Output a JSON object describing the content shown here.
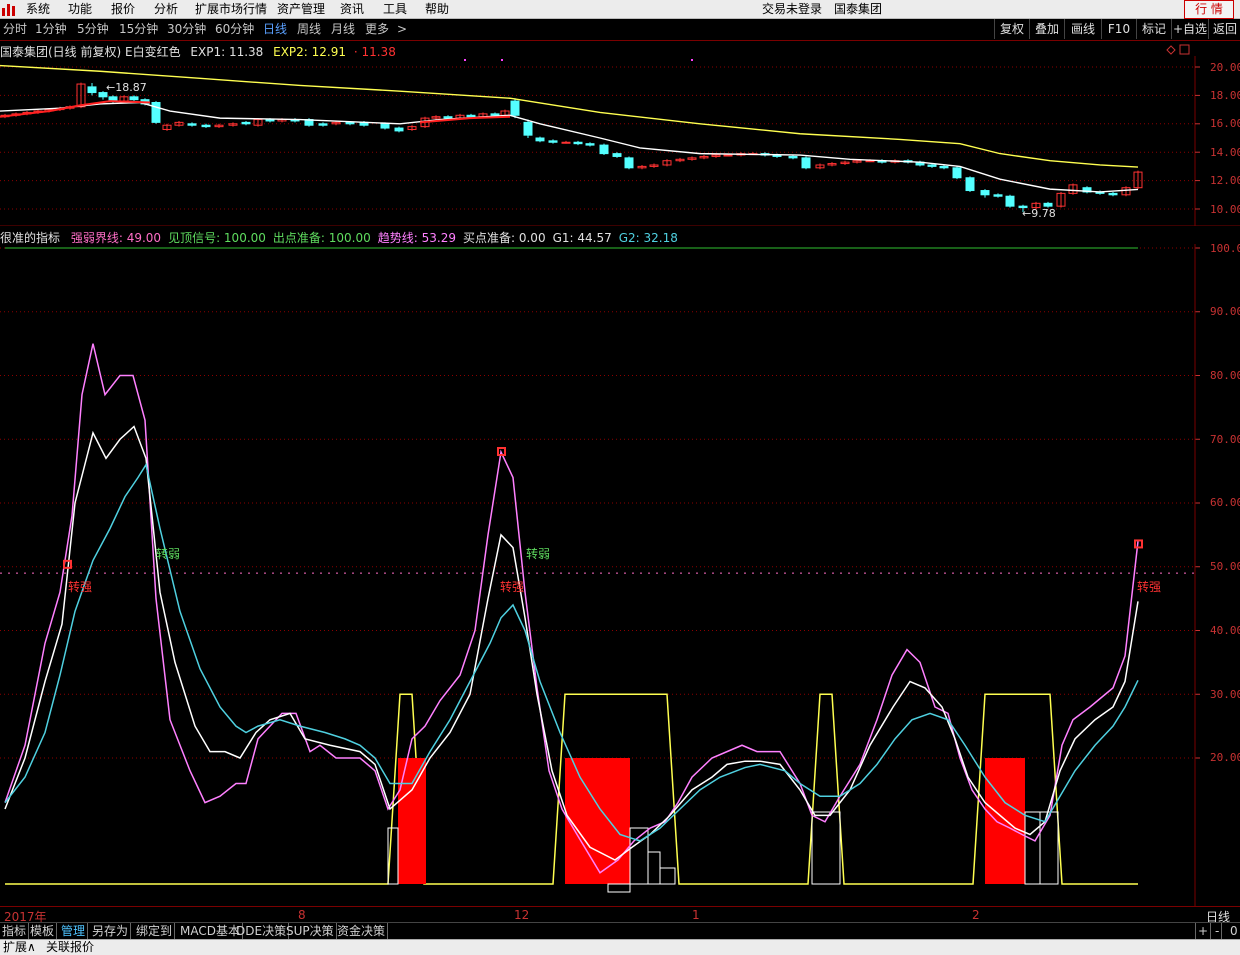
{
  "menu": {
    "items": [
      "系统",
      "功能",
      "报价",
      "分析",
      "扩展市场行情",
      "资产管理",
      "资讯",
      "工具",
      "帮助"
    ],
    "login_status": "交易未登录",
    "stock_name": "国泰集团",
    "quote_button": "行 情"
  },
  "periods": {
    "items": [
      "分时",
      "1分钟",
      "5分钟",
      "15分钟",
      "30分钟",
      "60分钟",
      "日线",
      "周线",
      "月线",
      "更多"
    ],
    "more_arrow": ">",
    "active": "日线",
    "tools": [
      "复权",
      "叠加",
      "画线",
      "F10",
      "标记",
      "+自选",
      "返回"
    ]
  },
  "main_panel": {
    "title": "国泰集团(日线 前复权) E白变红色",
    "exp1_label": "EXP1: 11.38",
    "exp2_label": "EXP2: 12.91",
    "price_label": "· 11.38",
    "high_label": "18.87",
    "low_label": "9.78",
    "axis": [
      "20.00",
      "18.00",
      "16.00",
      "14.00",
      "12.00",
      "10.00"
    ]
  },
  "indicator_panel": {
    "name": "很准的指标",
    "fields": [
      {
        "label": "强弱界线: 49.00",
        "color": "#ff6ec7"
      },
      {
        "label": "见顶信号: 100.00",
        "color": "#5fdc5f"
      },
      {
        "label": "出点准备: 100.00",
        "color": "#5fdc5f"
      },
      {
        "label": "趋势线: 53.29",
        "color": "#ff80ff"
      },
      {
        "label": "买点准备: 0.00",
        "color": "#e0e0e0"
      },
      {
        "label": "G1: 44.57",
        "color": "#e0e0e0"
      },
      {
        "label": "G2: 32.18",
        "color": "#4fd0e0"
      }
    ],
    "axis": [
      "100.00",
      "90.00",
      "80.00",
      "70.00",
      "60.00",
      "50.00",
      "40.00",
      "30.00",
      "20.00"
    ],
    "signals": {
      "weak": "转弱",
      "strong": "转强"
    }
  },
  "xaxis": {
    "labels": [
      "2017年",
      "8",
      "12",
      "1",
      "2"
    ],
    "period": "日线"
  },
  "bottom_tabs": {
    "items": [
      "指标",
      "模板",
      "管理",
      "另存为",
      "绑定到",
      "MACD基本",
      "DDE决策",
      "SUP决策",
      "资金决策"
    ],
    "active": "管理",
    "controls": [
      "+",
      "-",
      "0"
    ]
  },
  "status": {
    "expand": "扩展∧",
    "linked": "关联报价"
  },
  "colors": {
    "candle_up": "#ff3232",
    "candle_down": "#54ffff",
    "ma_white": "#ffffff",
    "ma_yellow": "#ffff50",
    "ma_red": "#ff2020",
    "line_pink": "#ff80ff",
    "line_cyan": "#4fd0e0",
    "line_yellow": "#ffff50",
    "bar_red": "#ff0000",
    "grid": "#8b0000"
  }
}
